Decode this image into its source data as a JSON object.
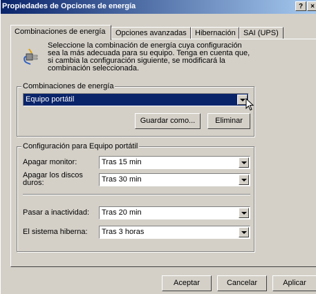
{
  "window": {
    "title": "Propiedades de Opciones de energía",
    "help_btn": "?",
    "close_btn": "×"
  },
  "tabs": [
    {
      "label": "Combinaciones de energía"
    },
    {
      "label": "Opciones avanzadas"
    },
    {
      "label": "Hibernación"
    },
    {
      "label": "SAI (UPS)"
    }
  ],
  "intro_text": "Seleccione la combinación de energía  cuya configuración sea la más adecuada para su equipo. Tenga en cuenta que, si cambia la configuración siguiente, se modificará la combinación seleccionada.",
  "schemes": {
    "group_label": "Combinaciones de energía",
    "selected": "Equipo portátil",
    "save_as": "Guardar como...",
    "delete": "Eliminar"
  },
  "settings": {
    "group_label": "Configuración para Equipo portátil",
    "monitor_label": "Apagar monitor:",
    "monitor_value": "Tras 15 min",
    "disks_label": "Apagar los discos duros:",
    "disks_value": "Tras 30 min",
    "standby_label": "Pasar a inactividad:",
    "standby_value": "Tras 20 min",
    "hibernate_label": "El sistema hiberna:",
    "hibernate_value": "Tras 3 horas"
  },
  "buttons": {
    "ok": "Aceptar",
    "cancel": "Cancelar",
    "apply": "Aplicar"
  }
}
